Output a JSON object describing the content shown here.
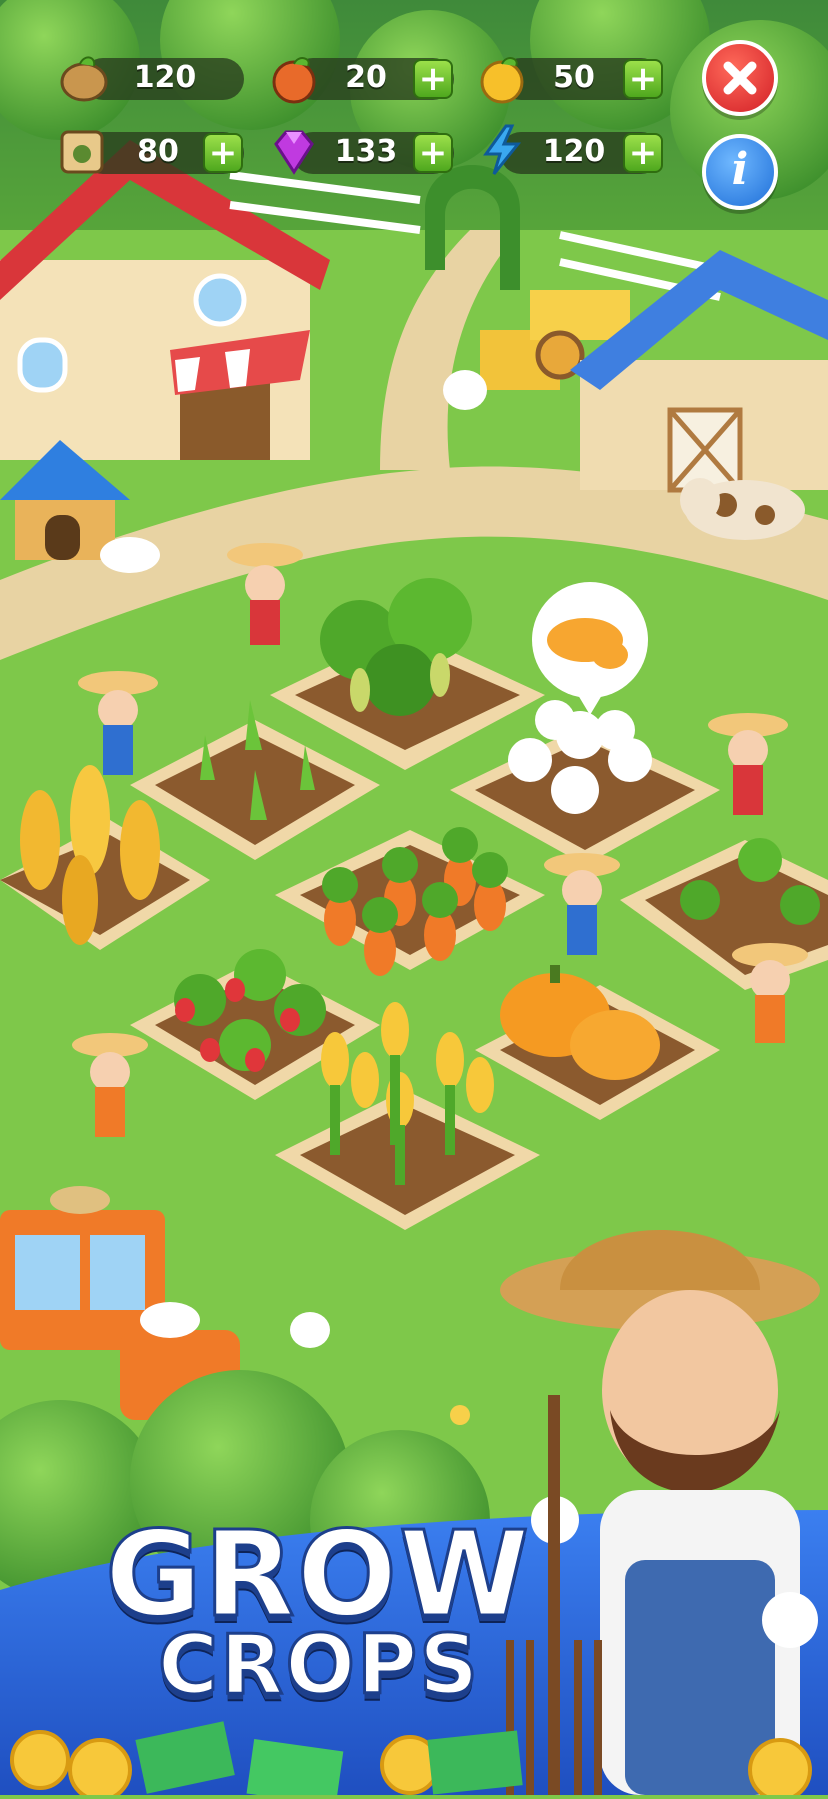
{
  "hud": {
    "resources": [
      {
        "id": "seeds",
        "icon": "potato-icon",
        "value": "120",
        "has_plus": false
      },
      {
        "id": "fruit",
        "icon": "mango-icon",
        "value": "20",
        "has_plus": true
      },
      {
        "id": "gold",
        "icon": "orange-icon",
        "value": "50",
        "has_plus": true
      },
      {
        "id": "fertilizer",
        "icon": "seed-bag-icon",
        "value": "80",
        "has_plus": true
      },
      {
        "id": "gems",
        "icon": "gem-icon",
        "value": "133",
        "has_plus": true
      },
      {
        "id": "energy",
        "icon": "lightning-icon",
        "value": "120",
        "has_plus": true
      }
    ],
    "plus_label": "+",
    "close_button": {
      "icon": "close-icon",
      "color": "#e53935"
    },
    "info_button": {
      "icon": "info-icon",
      "label": "i",
      "color": "#2f7fe0"
    }
  },
  "promo": {
    "line1": "GROW",
    "line2": "CROPS"
  },
  "colors": {
    "grass": "#7ec84a",
    "path": "#e8d3a3",
    "banner": "#2a6be0",
    "plus": "#5bb82a"
  }
}
